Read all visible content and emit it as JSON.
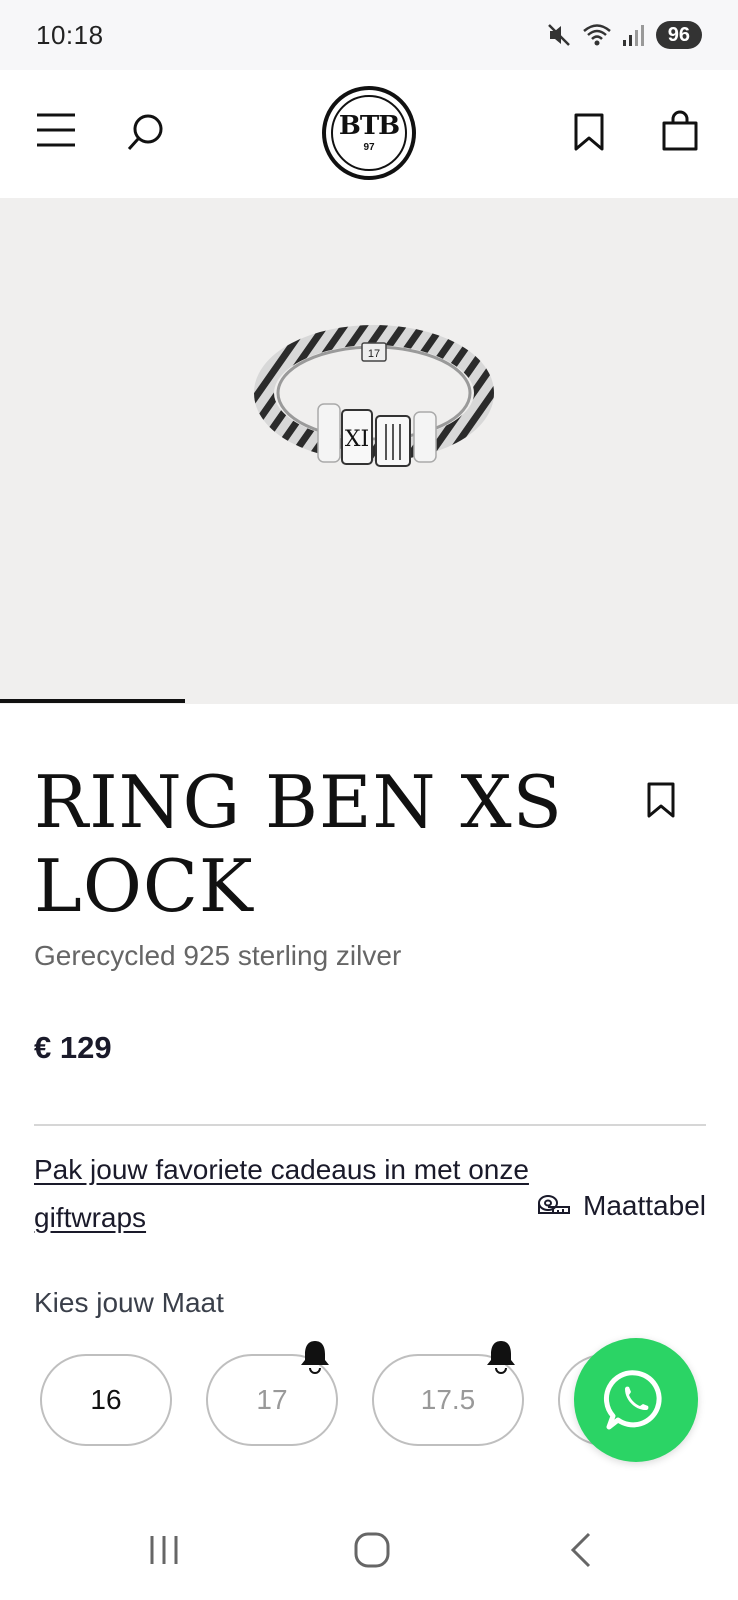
{
  "status_bar": {
    "time": "10:18",
    "battery": "96",
    "icons": [
      "mute-icon",
      "wifi-icon",
      "signal-icon"
    ]
  },
  "header": {
    "logo_text": "BTB",
    "logo_number": "97",
    "icons": [
      "menu-icon",
      "search-icon",
      "bookmark-icon",
      "shopping-bag-icon"
    ]
  },
  "product": {
    "title": "RING BEN XS LOCK",
    "subtitle": "Gerecycled 925 sterling zilver",
    "price": "€ 129",
    "gallery_progress": 0.25
  },
  "gift": {
    "link_text": "Pak jouw favoriete cadeaus in met onze giftwraps"
  },
  "size_chart": {
    "label": "Maattabel"
  },
  "sizes": {
    "label": "Kies jouw Maat",
    "options": [
      {
        "value": "16",
        "available": true
      },
      {
        "value": "17",
        "available": false
      },
      {
        "value": "17.5",
        "available": false
      }
    ]
  },
  "colors": {
    "whatsapp": "#2bd465",
    "gallery_bg": "#f0efee",
    "text_dark": "#1a1a2a"
  }
}
